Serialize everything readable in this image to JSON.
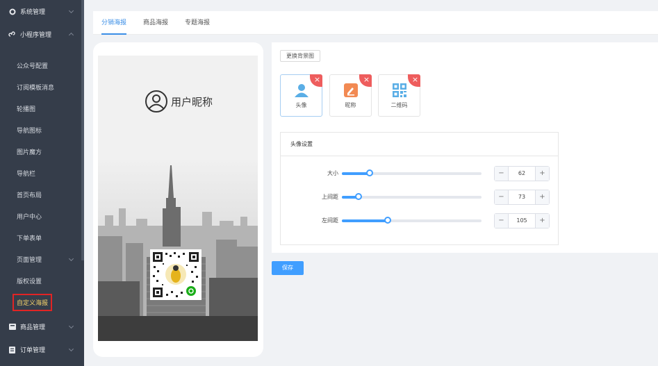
{
  "sidebar": {
    "groups": [
      {
        "label": "系统管理",
        "icon": "gear-icon"
      },
      {
        "label": "小程序管理",
        "icon": "mini-program-icon"
      },
      {
        "label": "商品管理",
        "icon": "goods-icon"
      },
      {
        "label": "订单管理",
        "icon": "order-icon"
      }
    ],
    "items": [
      {
        "label": "公众号配置"
      },
      {
        "label": "订阅模板消息"
      },
      {
        "label": "轮播图"
      },
      {
        "label": "导航图标"
      },
      {
        "label": "图片魔方"
      },
      {
        "label": "导航栏"
      },
      {
        "label": "首页布局"
      },
      {
        "label": "用户中心"
      },
      {
        "label": "下单表单"
      },
      {
        "label": "页面管理"
      },
      {
        "label": "版权设置"
      },
      {
        "label": "自定义海报"
      }
    ]
  },
  "tabs": [
    {
      "label": "分销海报"
    },
    {
      "label": "商品海报"
    },
    {
      "label": "专题海报"
    }
  ],
  "poster": {
    "nickname": "用户昵称"
  },
  "panel": {
    "change_bg_label": "更换背景图",
    "components": [
      {
        "label": "头像",
        "icon": "avatar-icon",
        "color": "#5aaee6"
      },
      {
        "label": "昵称",
        "icon": "edit-icon",
        "color": "#f28a53"
      },
      {
        "label": "二维码",
        "icon": "qrcode-icon",
        "color": "#5aaee6"
      }
    ],
    "delete_glyph": "×",
    "settings_title": "头像设置",
    "sliders": [
      {
        "label": "大小",
        "value": "62",
        "fraction": 0.2
      },
      {
        "label": "上间距",
        "value": "73",
        "fraction": 0.12
      },
      {
        "label": "左间距",
        "value": "105",
        "fraction": 0.33
      }
    ],
    "minus_glyph": "−",
    "plus_glyph": "+",
    "save_label": "保存"
  },
  "colors": {
    "accent": "#409eff",
    "sidebar_bg": "#353d4a",
    "highlight": "#e12424"
  }
}
